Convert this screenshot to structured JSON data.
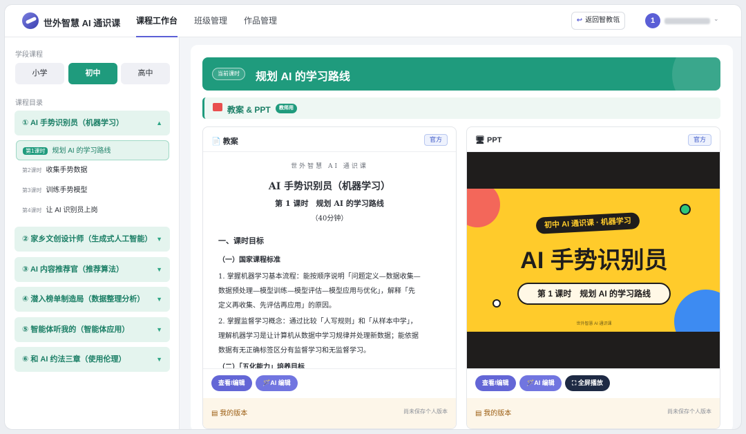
{
  "app": {
    "title": "世外智慧 AI 通识课"
  },
  "nav": [
    "课程工作台",
    "班级管理",
    "作品管理"
  ],
  "header": {
    "back_label": "返回智教瓴",
    "avatar_text": "1"
  },
  "sidebar": {
    "stage_label": "学段课程",
    "stages": [
      "小学",
      "初中",
      "高中"
    ],
    "catalog_label": "课程目录",
    "units": [
      "① AI 手势识别员（机器学习）",
      "② 家乡文创设计师（生成式人工智能）",
      "③ AI 内容推荐官（推荐算法）",
      "④ 潜入榜单制造局（数据整理分析）",
      "⑤ 智能体听我的（智能体应用）",
      "⑥ 和 AI 约法三章（使用伦理）"
    ],
    "lessons": [
      {
        "no": "第1课时",
        "title": "规划 AI 的学习路线"
      },
      {
        "no": "第2课时",
        "title": "收集手势数据"
      },
      {
        "no": "第3课时",
        "title": "训练手势模型"
      },
      {
        "no": "第4课时",
        "title": "让 AI 识别员上岗"
      }
    ]
  },
  "main": {
    "badge": "当前课时",
    "title": "规划 AI 的学习路线",
    "section_title": "教案 & PPT",
    "section_tag": "教师用",
    "official": "官方",
    "doc_card": {
      "title": "教案",
      "org": "世外智慧 AI 通识课",
      "heading": "AI 手势识别员（机器学习）",
      "lesson": "第 1 课时　规划 AI 的学习路线",
      "duration": "（40分钟）",
      "h1": "一、课时目标",
      "h2": "（一）国家课程标准",
      "p1a": "1. 掌握机器学习基本流程：能按顺序说明「问题定义—数据收集—",
      "p1b": "数据预处理—模型训练—模型评估—模型应用与优化」，解释「先",
      "p1c": "定义再收集、先评估再应用」的原因。",
      "p2a": "2. 掌握监督学习概念：通过比较「人写规则」和「从样本中学」，",
      "p2b": "理解机器学习是让计算机从数据中学习规律并处理新数据；能依据",
      "p2c": "数据有无正确标签区分有监督学习和无监督学习。",
      "h3": "（二）「五化能力」培养目标"
    },
    "ppt_card": {
      "title": "PPT",
      "pill": "初中 AI 通识课 · 机器学习",
      "headline": "AI 手势识别员",
      "subtitle": "第 1 课时　规划 AI 的学习路线",
      "footer": "世外智慧 AI 通识课"
    },
    "buttons": {
      "view": "查看/编辑",
      "ai": "AI 编辑",
      "full": "全屏播放"
    },
    "version": {
      "title": "我的版本",
      "status": "尚未保存个人版本"
    }
  }
}
